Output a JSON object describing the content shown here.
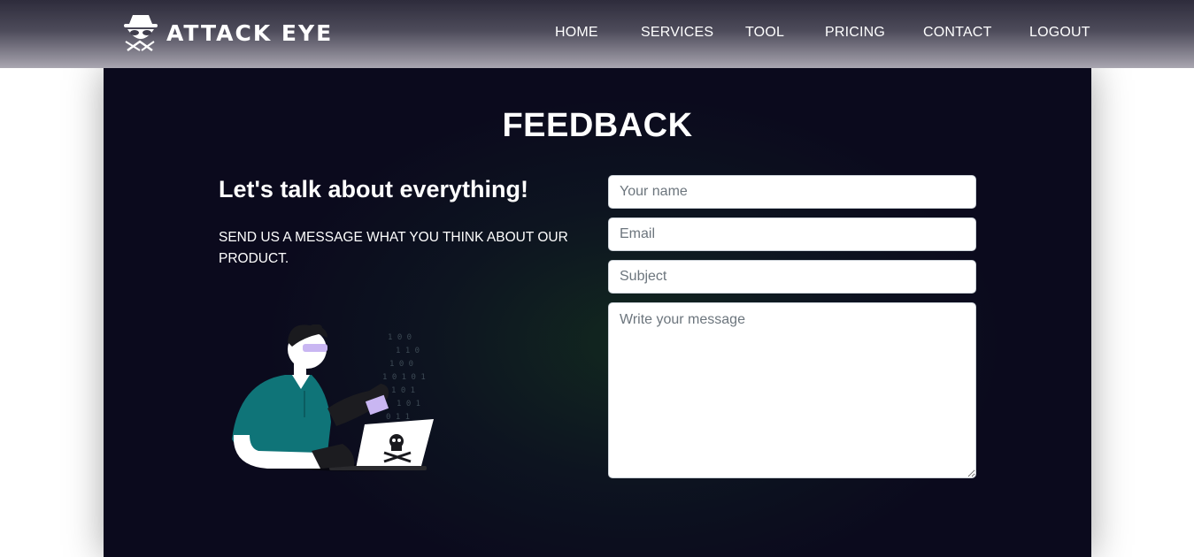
{
  "brand": {
    "name": "ATTACK EYE",
    "logo_icon": "spy-icon"
  },
  "nav": {
    "items": [
      {
        "label": "HOME"
      },
      {
        "label": "SERVICES"
      },
      {
        "label": "TOOL"
      },
      {
        "label": "PRICING"
      },
      {
        "label": "CONTACT"
      },
      {
        "label": "LOGOUT"
      }
    ]
  },
  "feedback": {
    "title": "FEEDBACK",
    "heading": "Let's talk about everything!",
    "subtext": "SEND US A MESSAGE WHAT YOU THINK ABOUT OUR PRODUCT.",
    "illustration_icon": "hacker-laptop-illustration",
    "form": {
      "name_placeholder": "Your name",
      "email_placeholder": "Email",
      "subject_placeholder": "Subject",
      "message_placeholder": "Write your message"
    }
  },
  "colors": {
    "navbar_top": "#2e2c3c",
    "navbar_bottom": "#aaa7b1",
    "panel_bg": "#0b0a1d",
    "accent_teal": "#0f7478",
    "accent_purple": "#c9b6f2"
  }
}
